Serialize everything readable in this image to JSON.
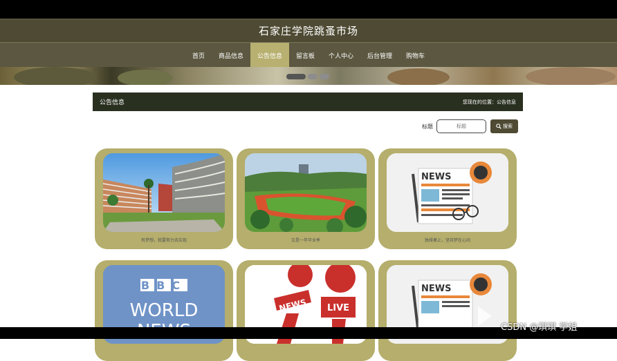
{
  "site": {
    "title": "石家庄学院跳蚤市场"
  },
  "nav": [
    {
      "label": "首页"
    },
    {
      "label": "商品信息"
    },
    {
      "label": "公告信息"
    },
    {
      "label": "留言板"
    },
    {
      "label": "个人中心"
    },
    {
      "label": "后台管理"
    },
    {
      "label": "购物车"
    }
  ],
  "nav_active_index": 2,
  "section": {
    "title": "公告信息",
    "location": "您现在的位置：公告信息"
  },
  "search": {
    "label": "标题",
    "placeholder": "标题",
    "button": "搜索",
    "icon": "search-icon"
  },
  "cards": [
    {
      "caption": "有梦想，就要努力去实现",
      "image": "campus-building"
    },
    {
      "caption": "又是一年毕业季",
      "image": "campus-sports-field"
    },
    {
      "caption": "独排莫上，坚持梦在心间",
      "image": "news-illustration"
    },
    {
      "caption": "",
      "image": "bbc-world-news"
    },
    {
      "caption": "",
      "image": "news-live-microphones"
    },
    {
      "caption": "",
      "image": "news-illustration"
    }
  ],
  "bbc": {
    "brand": "BBC",
    "line1": "WORLD",
    "line2": "NEWS"
  },
  "mic": {
    "tag1": "NEWS",
    "tag2": "LIVE"
  },
  "news_art": {
    "heading": "NEWS"
  },
  "watermark": "CSDN @琪琪 学姐",
  "colors": {
    "header": "#4e4a33",
    "nav": "#5b5740",
    "active": "#b8b070",
    "card": "#b5ae6c",
    "crumb": "#2a3020"
  }
}
